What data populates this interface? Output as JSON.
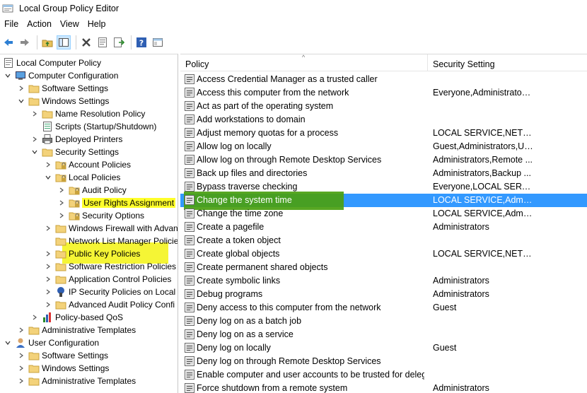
{
  "window": {
    "title": "Local Group Policy Editor"
  },
  "menu": [
    "File",
    "Action",
    "View",
    "Help"
  ],
  "toolbar": [
    {
      "icon": "back-arrow-icon"
    },
    {
      "icon": "forward-arrow-icon"
    },
    {
      "icon": "up-folder-icon"
    },
    {
      "icon": "show-hide-tree-icon",
      "pressed": true
    },
    {
      "icon": "delete-x-icon"
    },
    {
      "icon": "properties-icon"
    },
    {
      "icon": "export-list-icon"
    },
    {
      "icon": "help-icon"
    },
    {
      "icon": "console-view-icon"
    }
  ],
  "tree": [
    {
      "label": "Local Computer Policy",
      "level": 0,
      "expander": "",
      "icon": "policy-doc-icon"
    },
    {
      "label": "Computer Configuration",
      "level": 1,
      "expander": "open",
      "icon": "computer-icon"
    },
    {
      "label": "Software Settings",
      "level": 2,
      "expander": "closed",
      "icon": "folder-icon"
    },
    {
      "label": "Windows Settings",
      "level": 2,
      "expander": "open",
      "icon": "folder-icon"
    },
    {
      "label": "Name Resolution Policy",
      "level": 3,
      "expander": "closed",
      "icon": "folder-icon"
    },
    {
      "label": "Scripts (Startup/Shutdown)",
      "level": 3,
      "expander": "",
      "icon": "script-icon"
    },
    {
      "label": "Deployed Printers",
      "level": 3,
      "expander": "closed",
      "icon": "printer-icon"
    },
    {
      "label": "Security Settings",
      "level": 3,
      "expander": "open",
      "icon": "folder-icon"
    },
    {
      "label": "Account Policies",
      "level": 4,
      "expander": "closed",
      "icon": "folder-lock-icon"
    },
    {
      "label": "Local Policies",
      "level": 4,
      "expander": "open",
      "icon": "folder-lock-icon"
    },
    {
      "label": "Audit Policy",
      "level": 5,
      "expander": "closed",
      "icon": "folder-lock-icon"
    },
    {
      "label": "User Rights Assignment",
      "level": 5,
      "expander": "closed",
      "icon": "folder-lock-icon",
      "selected": true
    },
    {
      "label": "Security Options",
      "level": 5,
      "expander": "closed",
      "icon": "folder-lock-icon"
    },
    {
      "label": "Windows Firewall with Advan",
      "level": 4,
      "expander": "closed",
      "icon": "folder-icon"
    },
    {
      "label": "Network List Manager Policie",
      "level": 4,
      "expander": "",
      "icon": "folder-icon"
    },
    {
      "label": "Public Key Policies",
      "level": 4,
      "expander": "closed",
      "icon": "folder-icon"
    },
    {
      "label": "Software Restriction Policies",
      "level": 4,
      "expander": "closed",
      "icon": "folder-icon"
    },
    {
      "label": "Application Control Policies",
      "level": 4,
      "expander": "closed",
      "icon": "folder-icon"
    },
    {
      "label": "IP Security Policies on Local C",
      "level": 4,
      "expander": "closed",
      "icon": "ipsec-icon"
    },
    {
      "label": "Advanced Audit Policy Confi",
      "level": 4,
      "expander": "closed",
      "icon": "folder-icon"
    },
    {
      "label": "Policy-based QoS",
      "level": 3,
      "expander": "closed",
      "icon": "chart-bars-icon"
    },
    {
      "label": "Administrative Templates",
      "level": 2,
      "expander": "closed",
      "icon": "folder-icon"
    },
    {
      "label": "User Configuration",
      "level": 1,
      "expander": "open",
      "icon": "user-icon"
    },
    {
      "label": "Software Settings",
      "level": 2,
      "expander": "closed",
      "icon": "folder-icon"
    },
    {
      "label": "Windows Settings",
      "level": 2,
      "expander": "closed",
      "icon": "folder-icon"
    },
    {
      "label": "Administrative Templates",
      "level": 2,
      "expander": "closed",
      "icon": "folder-icon"
    }
  ],
  "list": {
    "col_policy": "Policy",
    "col_setting": "Security Setting",
    "rows": [
      {
        "policy": "Access Credential Manager as a trusted caller",
        "setting": ""
      },
      {
        "policy": "Access this computer from the network",
        "setting": "Everyone,Administrators..."
      },
      {
        "policy": "Act as part of the operating system",
        "setting": ""
      },
      {
        "policy": "Add workstations to domain",
        "setting": ""
      },
      {
        "policy": "Adjust memory quotas for a process",
        "setting": "LOCAL SERVICE,NETWO..."
      },
      {
        "policy": "Allow log on locally",
        "setting": "Guest,Administrators,Us..."
      },
      {
        "policy": "Allow log on through Remote Desktop Services",
        "setting": "Administrators,Remote ..."
      },
      {
        "policy": "Back up files and directories",
        "setting": "Administrators,Backup ..."
      },
      {
        "policy": "Bypass traverse checking",
        "setting": "Everyone,LOCAL SERVIC..."
      },
      {
        "policy": "Change the system time",
        "setting": "LOCAL SERVICE,Admini...",
        "selected": true
      },
      {
        "policy": "Change the time zone",
        "setting": "LOCAL SERVICE,Admini..."
      },
      {
        "policy": "Create a pagefile",
        "setting": "Administrators"
      },
      {
        "policy": "Create a token object",
        "setting": ""
      },
      {
        "policy": "Create global objects",
        "setting": "LOCAL SERVICE,NETWO..."
      },
      {
        "policy": "Create permanent shared objects",
        "setting": ""
      },
      {
        "policy": "Create symbolic links",
        "setting": "Administrators"
      },
      {
        "policy": "Debug programs",
        "setting": "Administrators"
      },
      {
        "policy": "Deny access to this computer from the network",
        "setting": "Guest"
      },
      {
        "policy": "Deny log on as a batch job",
        "setting": ""
      },
      {
        "policy": "Deny log on as a service",
        "setting": ""
      },
      {
        "policy": "Deny log on locally",
        "setting": "Guest"
      },
      {
        "policy": "Deny log on through Remote Desktop Services",
        "setting": ""
      },
      {
        "policy": "Enable computer and user accounts to be trusted for delega...",
        "setting": ""
      },
      {
        "policy": "Force shutdown from a remote system",
        "setting": "Administrators"
      }
    ]
  }
}
